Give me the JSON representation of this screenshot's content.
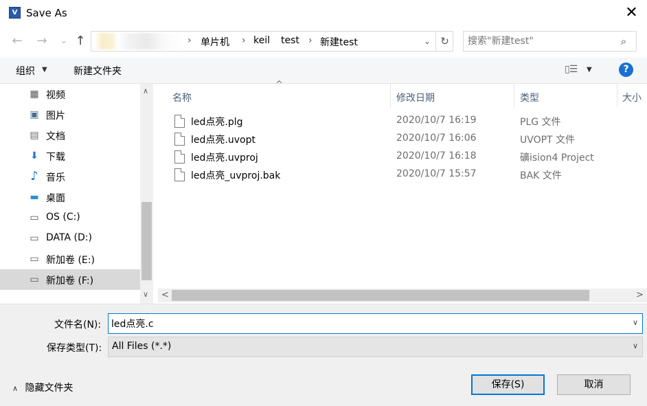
{
  "window": {
    "title": "Save As",
    "app_icon_text": "V",
    "close_symbol": "✕"
  },
  "nav_buttons": {
    "back": "←",
    "forward": "→",
    "recent": "⌄",
    "up": "↑"
  },
  "address": {
    "breadcrumbs": [
      "单片机",
      "keil",
      "test",
      "新建test"
    ],
    "separator": "›",
    "dropdown": "⌄",
    "refresh": "↻"
  },
  "search": {
    "placeholder": "搜索\"新建test\"",
    "icon": "⌕"
  },
  "toolbar": {
    "organize_label": "组织",
    "organize_arrow": "▼",
    "new_folder_label": "新建文件夹",
    "view_icon": "▯☰",
    "view_arrow": "▼",
    "help_label": "?"
  },
  "sidebar": {
    "items": [
      {
        "label": "视频",
        "icon": "▦"
      },
      {
        "label": "图片",
        "icon": "▣"
      },
      {
        "label": "文档",
        "icon": "▤"
      },
      {
        "label": "下载",
        "icon": "⬇"
      },
      {
        "label": "音乐",
        "icon": "♪"
      },
      {
        "label": "桌面",
        "icon": "▬"
      },
      {
        "label": "OS (C:)",
        "icon": "▭"
      },
      {
        "label": "DATA (D:)",
        "icon": "▭"
      },
      {
        "label": "新加卷 (E:)",
        "icon": "▭"
      },
      {
        "label": "新加卷 (F:)",
        "icon": "▭",
        "selected": true
      }
    ],
    "scroll_up": "∧",
    "scroll_down": "∨"
  },
  "file_list": {
    "columns": [
      "名称",
      "修改日期",
      "类型",
      "大小"
    ],
    "sort_indicator": "^",
    "rows": [
      {
        "name": "led点亮.plg",
        "date": "2020/10/7 16:19",
        "type": "PLG 文件"
      },
      {
        "name": "led点亮.uvopt",
        "date": "2020/10/7 16:06",
        "type": "UVOPT 文件"
      },
      {
        "name": "led点亮.uvproj",
        "date": "2020/10/7 16:18",
        "type": "礦ision4 Project"
      },
      {
        "name": "led点亮_uvproj.bak",
        "date": "2020/10/7 15:57",
        "type": "BAK 文件"
      }
    ],
    "scroll_left": "<",
    "scroll_right": ">"
  },
  "form": {
    "filename_label": "文件名(N):",
    "filename_value": "led点亮.c",
    "filetype_label": "保存类型(T):",
    "filetype_value": "All Files (*.*)",
    "dropdown_arrow": "∨",
    "hide_folders_label": "隐藏文件夹",
    "hide_folders_arrow": "∧",
    "save_label": "保存(S)",
    "cancel_label": "取消"
  }
}
